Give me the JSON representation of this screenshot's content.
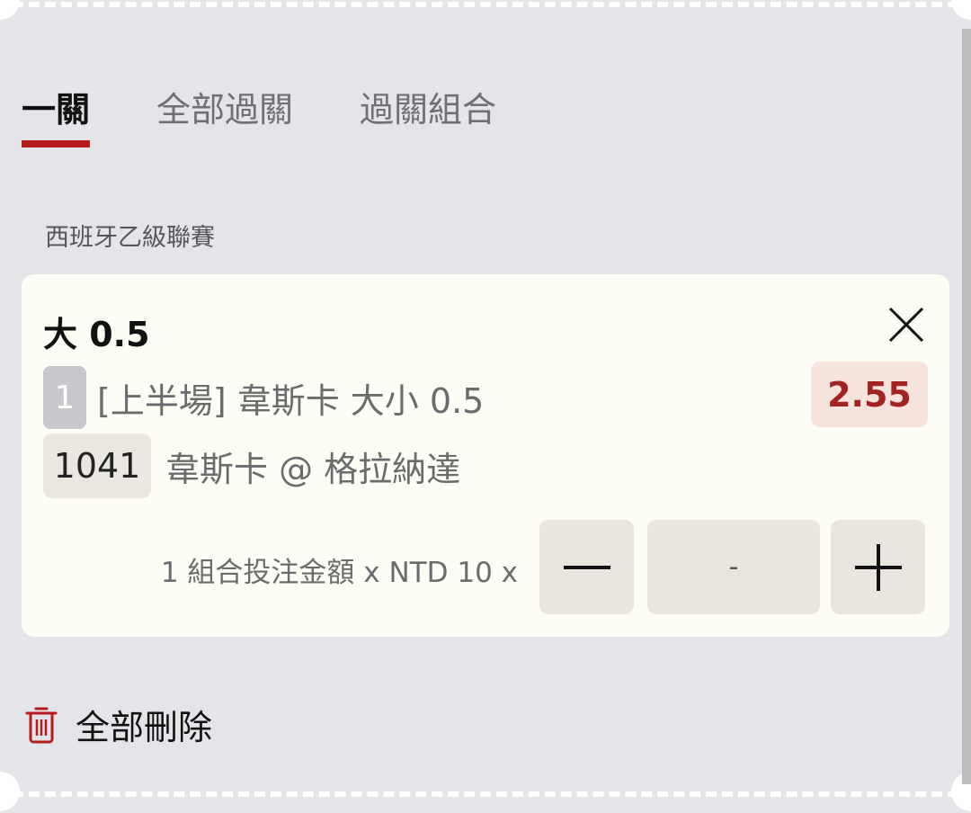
{
  "tabs": [
    {
      "label": "一關",
      "active": true
    },
    {
      "label": "全部過關",
      "active": false
    },
    {
      "label": "過關組合",
      "active": false
    }
  ],
  "league": "西班牙乙級聯賽",
  "bet": {
    "selection": "大 0.5",
    "leg_number": "1",
    "market": "[上半場] 韋斯卡 大小 0.5",
    "odds": "2.55",
    "match_id": "1041",
    "match": "韋斯卡 @ 格拉納達",
    "stake_label": "1 組合投注金額 x NTD 10 x",
    "stake_value": "-",
    "close_icon": "close-icon",
    "minus_icon": "minus-icon",
    "plus_icon": "plus-icon"
  },
  "footer": {
    "delete_all_label": "全部刪除",
    "delete_icon": "trash-icon"
  },
  "colors": {
    "background": "#e4e5e8",
    "card": "#fefdf5",
    "accent_red": "#b71c1c",
    "odds_text": "#a32222",
    "odds_bg": "#f5e3dc"
  }
}
